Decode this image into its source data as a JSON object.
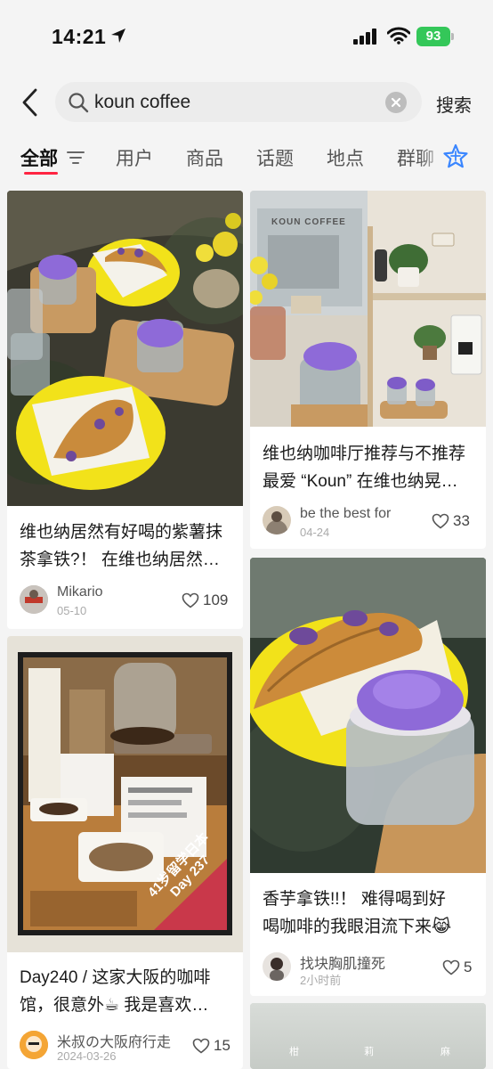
{
  "status_bar": {
    "time": "14:21",
    "battery": "93"
  },
  "search": {
    "query": "koun coffee",
    "button_label": "搜索"
  },
  "tabs": [
    {
      "label": "全部",
      "active": true
    },
    {
      "label": "用户"
    },
    {
      "label": "商品"
    },
    {
      "label": "话题"
    },
    {
      "label": "地点"
    },
    {
      "label": "群聊"
    }
  ],
  "colors": {
    "accent": "#ff2442",
    "battery": "#34c759",
    "plate_yellow": "#f2e21a",
    "taro_purple": "#8e6ad8"
  },
  "icons": {
    "back": "chevron-left-icon",
    "search": "search-icon",
    "clear": "clear-icon",
    "filter": "filter-icon",
    "more": "sparkle-star-icon",
    "like": "heart-outline-icon"
  },
  "posts": [
    {
      "title_line1": "维也纳居然有好喝的紫薯抹",
      "title_line2": "茶拿铁?！ 在维也纳居然…",
      "author": "Mikario",
      "date": "05-10",
      "likes": "109"
    },
    {
      "title_line1": "维也纳咖啡厅推荐与不推荐",
      "title_line2": "最爱 “Koun” 在维也纳晃…",
      "author": "be the best for",
      "date": "04-24",
      "likes": "33",
      "image_sign": "KOUN COFFEE"
    },
    {
      "title_line1": "Day240 / 这家大阪的咖啡",
      "title_line2": "馆，很意外☕ 我是喜欢…",
      "author": "米叔の大阪府行走",
      "date": "2024-03-26",
      "likes": "15",
      "banner_line1": "41岁留学日本",
      "banner_line2": "Day 237"
    },
    {
      "title_line1": "香芋拿铁!!！ 难得喝到好",
      "title_line2": "喝咖啡的我眼泪流下来😹",
      "author": "找块胸肌撞死",
      "date": "2小时前",
      "likes": "5"
    },
    {
      "vertical_text": [
        "柑",
        "莉",
        "麻"
      ]
    }
  ]
}
